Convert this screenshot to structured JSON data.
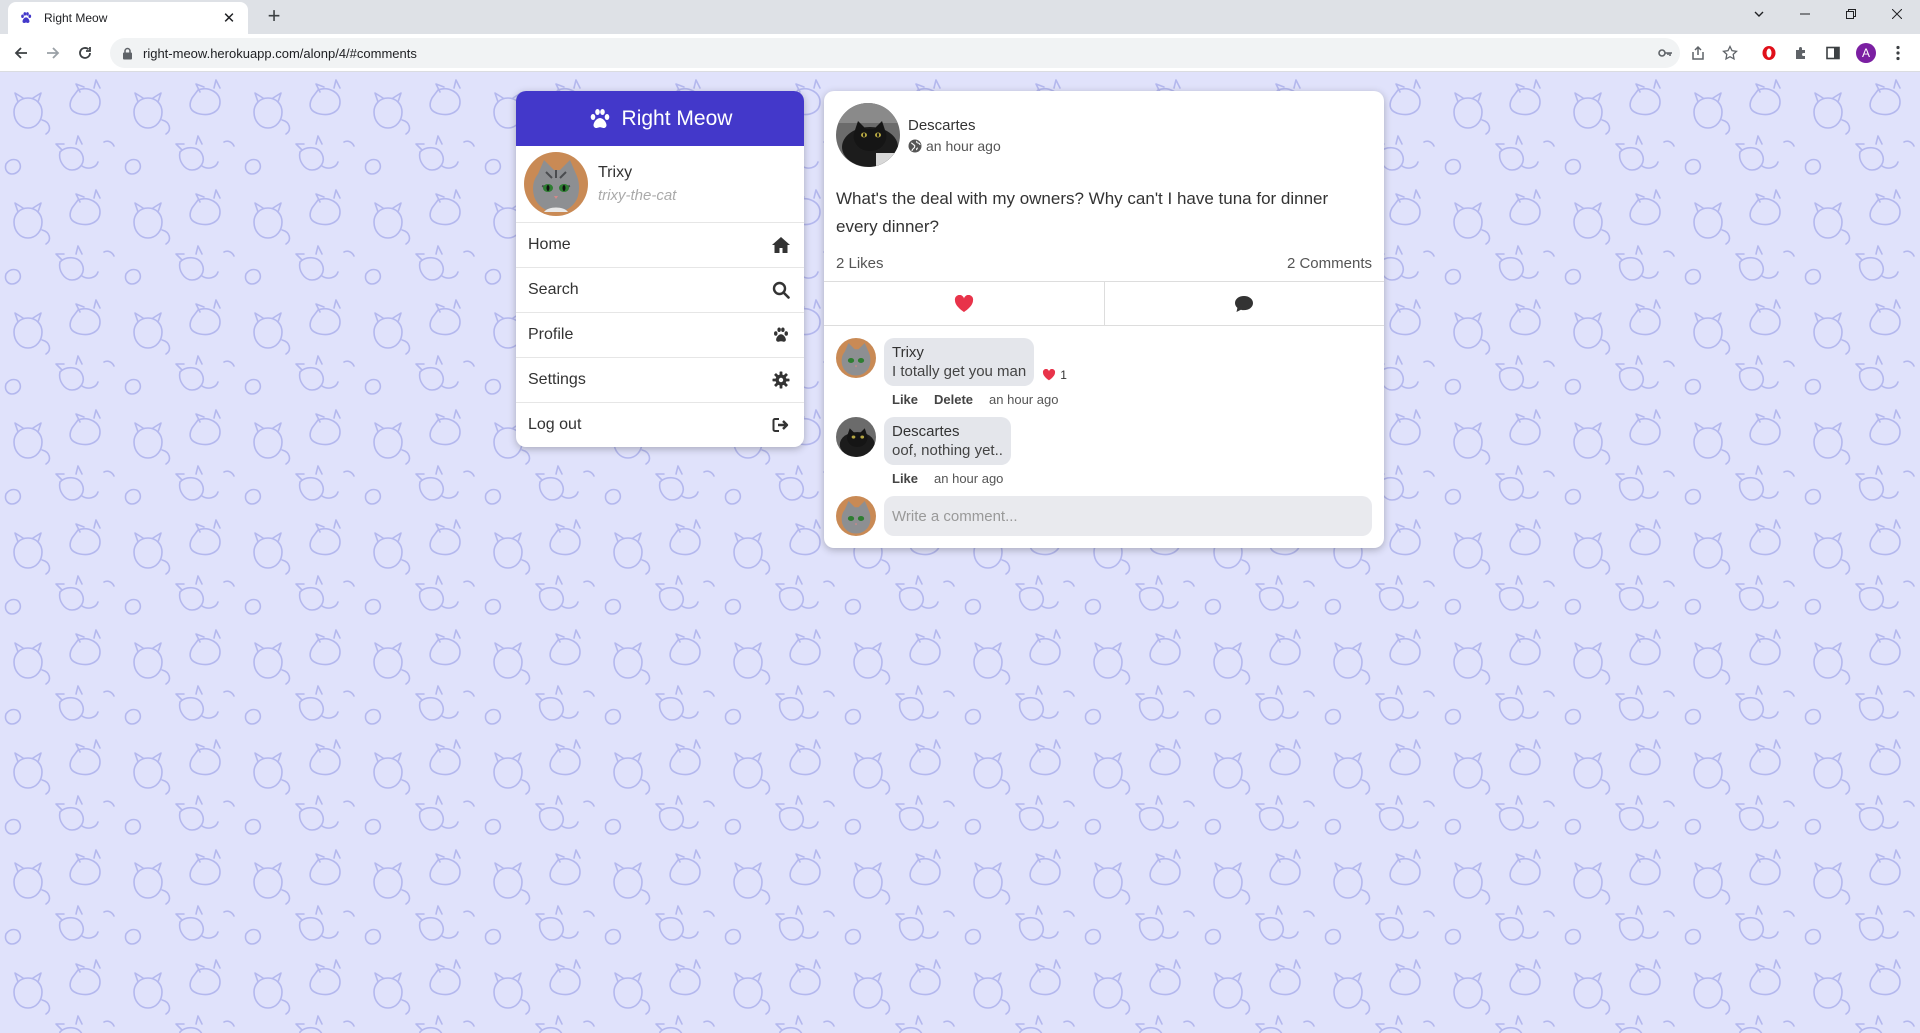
{
  "browser": {
    "tab_title": "Right Meow",
    "url": "right-meow.herokuapp.com/alonp/4/#comments",
    "profile_initial": "A"
  },
  "app": {
    "brand": "Right Meow",
    "accent_color": "#4338ca",
    "background_color": "#e0e2fb"
  },
  "current_user": {
    "name": "Trixy",
    "handle": "trixy-the-cat"
  },
  "menu": [
    {
      "label": "Home",
      "icon": "home-icon"
    },
    {
      "label": "Search",
      "icon": "search-icon"
    },
    {
      "label": "Profile",
      "icon": "paw-icon"
    },
    {
      "label": "Settings",
      "icon": "gear-icon"
    },
    {
      "label": "Log out",
      "icon": "logout-icon"
    }
  ],
  "post": {
    "author": "Descartes",
    "time": "an hour ago",
    "visibility_icon": "globe-icon",
    "text": "What's the deal with my owners? Why can't I have tuna for dinner every dinner?",
    "likes": "2 Likes",
    "comments_count": "2 Comments",
    "like_icon": "heart-icon",
    "comment_icon": "comment-icon"
  },
  "comments": [
    {
      "author": "Trixy",
      "text": "I totally get you man",
      "likes": "1",
      "like_label": "Like",
      "delete_label": "Delete",
      "time": "an hour ago"
    },
    {
      "author": "Descartes",
      "text": "oof, nothing yet..",
      "like_label": "Like",
      "time": "an hour ago"
    }
  ],
  "comment_input": {
    "placeholder": "Write a comment..."
  }
}
